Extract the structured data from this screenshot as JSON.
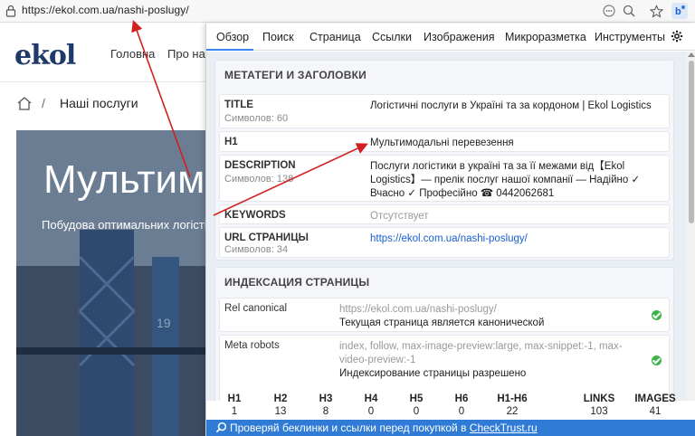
{
  "browser": {
    "url_host": "https://ekol.com.ua",
    "url_path": "/nashi-poslugy/"
  },
  "site": {
    "logo": "ekol",
    "nav": [
      "Головна",
      "Про нас"
    ],
    "breadcrumb_current": "Наші послуги",
    "hero_title": "Мультимо",
    "hero_subtitle": "Побудова оптимальних логісті"
  },
  "panel": {
    "tabs": [
      "Обзор",
      "Поиск",
      "Страница",
      "Ссылки",
      "Изображения",
      "Микроразметка",
      "Инструменты"
    ],
    "meta_section": {
      "title": "МЕТАТЕГИ И ЗАГОЛОВКИ",
      "title_label": "TITLE",
      "title_count": "Символов: 60",
      "title_value": "Логістичні послуги в Україні та за кордоном | Ekol Logistics",
      "h1_label": "H1",
      "h1_value": "Мультимодальні перевезення",
      "description_label": "DESCRIPTION",
      "description_count": "Символов: 138",
      "description_value": "Послуги логістики в україні та за її межами від【Ekol Logistics】— прелік послуг нашої компанії — Надійно ✓ Вчасно ✓ Професійно ☎ 0442062681",
      "keywords_label": "KEYWORDS",
      "keywords_value": "Отсутствует",
      "url_label": "URL СТРАНИЦЫ",
      "url_count": "Символов: 34",
      "url_value": "https://ekol.com.ua/nashi-poslugy/"
    },
    "index_section": {
      "title": "ИНДЕКСАЦИЯ СТРАНИЦЫ",
      "canonical_label": "Rel canonical",
      "canonical_url": "https://ekol.com.ua/nashi-poslugy/",
      "canonical_note": "Текущая страница является канонической",
      "robots_label": "Meta robots",
      "robots_value": "index, follow, max-image-preview:large, max-snippet:-1, max-video-preview:-1",
      "robots_note": "Индексирование страницы разрешено"
    },
    "stats": [
      {
        "label": "H1",
        "value": "1"
      },
      {
        "label": "H2",
        "value": "13"
      },
      {
        "label": "H3",
        "value": "8"
      },
      {
        "label": "H4",
        "value": "0"
      },
      {
        "label": "H5",
        "value": "0"
      },
      {
        "label": "H6",
        "value": "0"
      },
      {
        "label": "H1-H6",
        "value": "22"
      },
      {
        "label": "LINKS",
        "value": "103"
      },
      {
        "label": "IMAGES",
        "value": "41"
      }
    ],
    "footer_text": "Проверяй беклинки и ссылки перед покупкой в ",
    "footer_link": "CheckTrust.ru"
  },
  "colors": {
    "accent": "#2f7bd6",
    "link": "#1a5fd0",
    "arrow": "#d0201f",
    "ok": "#3bb54a"
  }
}
